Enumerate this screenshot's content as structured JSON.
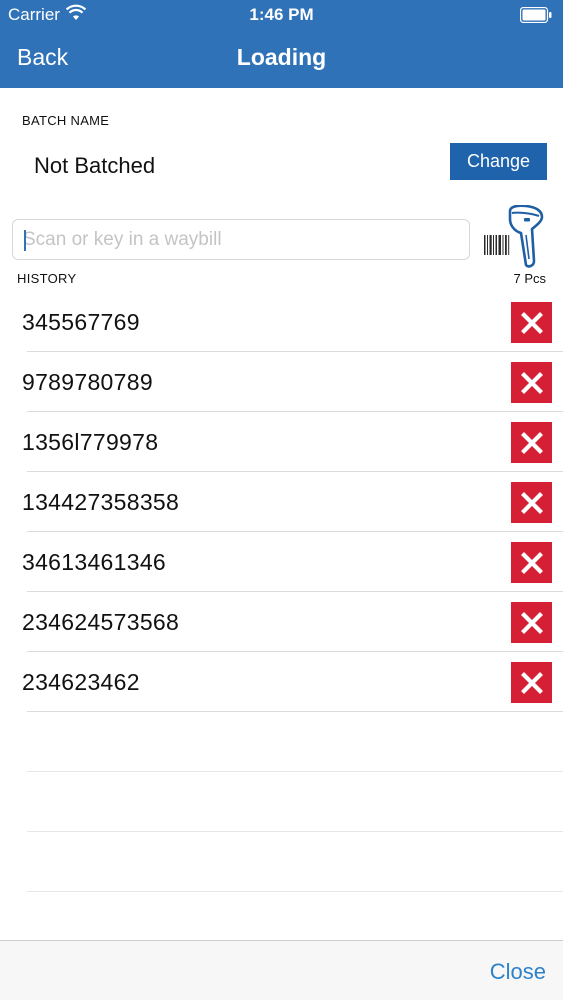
{
  "status_bar": {
    "carrier": "Carrier",
    "time": "1:46 PM",
    "icons": [
      "wifi-icon",
      "battery-icon"
    ]
  },
  "nav": {
    "back_label": "Back",
    "title": "Loading"
  },
  "batch": {
    "label": "BATCH NAME",
    "name": "Not Batched",
    "change_label": "Change"
  },
  "scan": {
    "placeholder": "Scan or key in a waybill",
    "value": "",
    "icons": [
      "barcode-icon",
      "scanner-icon"
    ]
  },
  "history": {
    "label": "HISTORY",
    "count": "7 Pcs",
    "items": [
      {
        "waybill": "345567769"
      },
      {
        "waybill": "9789780789"
      },
      {
        "waybill": "1356l779978"
      },
      {
        "waybill": "134427358358"
      },
      {
        "waybill": "34613461346"
      },
      {
        "waybill": "234624573568"
      },
      {
        "waybill": "234623462"
      }
    ]
  },
  "footer": {
    "close_label": "Close"
  },
  "colors": {
    "header": "#2f72b8",
    "button": "#1f63ad",
    "delete": "#d41f35",
    "link": "#2f82c8"
  }
}
